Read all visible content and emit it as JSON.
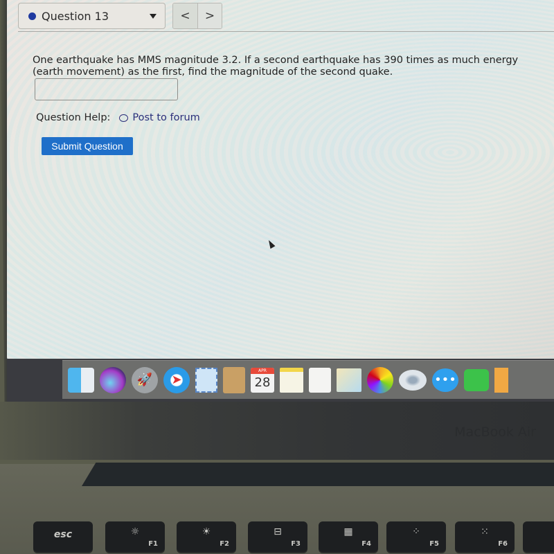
{
  "header": {
    "question_selector": {
      "label": "Question 13",
      "status_dot_color": "#1f3aa0"
    },
    "prev_label": "<",
    "next_label": ">"
  },
  "question": {
    "text": "One earthquake has MMS magnitude 3.2. If a second earthquake has 390 times as much energy (earth movement) as the first, find the magnitude of the second quake.",
    "answer_value": "",
    "help_label": "Question Help:",
    "forum_link": "Post to forum",
    "submit_label": "Submit Question",
    "submit_color": "#1f6fc9"
  },
  "dock": {
    "items": [
      {
        "name": "Finder",
        "icon": "finder-icon"
      },
      {
        "name": "Siri",
        "icon": "siri-icon"
      },
      {
        "name": "Launchpad",
        "icon": "rocket-icon"
      },
      {
        "name": "Safari",
        "icon": "compass-icon"
      },
      {
        "name": "Mail",
        "icon": "stamp-icon"
      },
      {
        "name": "Contacts",
        "icon": "contacts-icon"
      },
      {
        "name": "Calendar",
        "icon": "calendar-icon",
        "month": "APR",
        "day": "28"
      },
      {
        "name": "Notes",
        "icon": "notes-icon"
      },
      {
        "name": "Reminders",
        "icon": "list-icon"
      },
      {
        "name": "Maps",
        "icon": "map-icon"
      },
      {
        "name": "Photos",
        "icon": "photos-icon"
      },
      {
        "name": "DVD Player",
        "icon": "disc-icon"
      },
      {
        "name": "Messages",
        "icon": "chat-icon"
      },
      {
        "name": "FaceTime",
        "icon": "video-call-icon"
      },
      {
        "name": "Preview",
        "icon": "preview-icon"
      }
    ]
  },
  "laptop": {
    "brand": "MacBook Air",
    "keys": [
      {
        "label": "esc",
        "fn": ""
      },
      {
        "label": "☼",
        "fn": "F1"
      },
      {
        "label": "☀",
        "fn": "F2"
      },
      {
        "label": "⊟",
        "fn": "F3"
      },
      {
        "label": "▦",
        "fn": "F4"
      },
      {
        "label": "⁘",
        "fn": "F5"
      },
      {
        "label": "⁙",
        "fn": "F6"
      }
    ]
  }
}
